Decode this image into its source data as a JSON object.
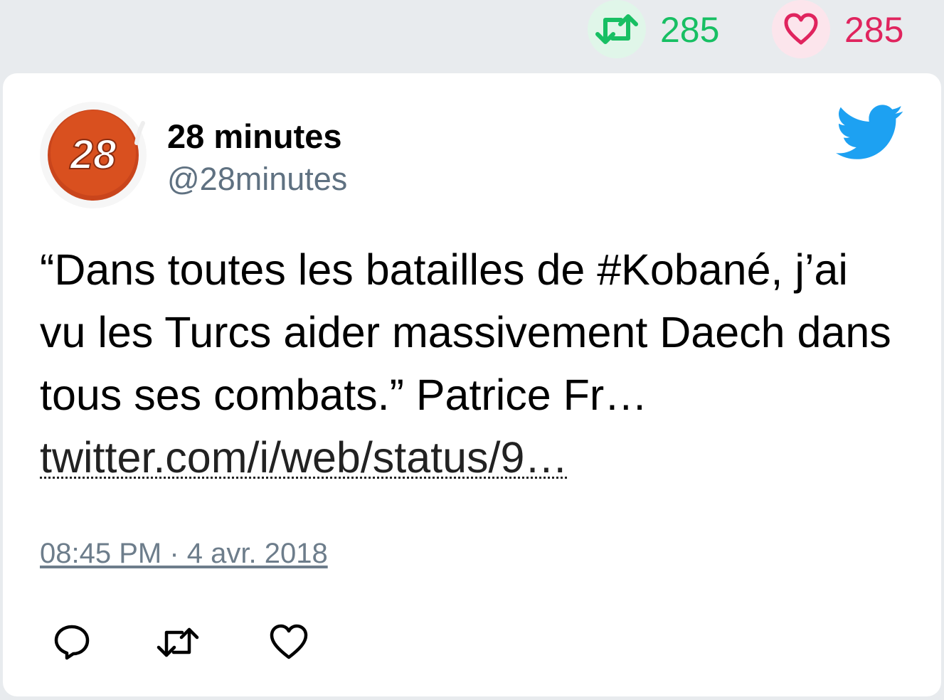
{
  "stats": {
    "retweet_count": "285",
    "like_count": "285",
    "retweet_color": "#17bf63",
    "like_color": "#e0245e"
  },
  "author": {
    "name": "28 minutes",
    "handle": "@28minutes",
    "avatar_text": "28"
  },
  "tweet": {
    "text": "“Dans toutes les batailles de #Kobané, j’ai vu les Turcs aider massivement Daech dans tous ses combats.” Patrice Fr…",
    "link": "twitter.com/i/web/status/9…",
    "timestamp": "08:45 PM · 4 avr. 2018"
  },
  "icons": {
    "retweet": "retweet-icon",
    "like": "heart-icon",
    "bird": "twitter-bird-icon",
    "reply": "reply-icon"
  },
  "colors": {
    "twitter_blue": "#1da1f2",
    "avatar_red": "#d94a1f"
  }
}
